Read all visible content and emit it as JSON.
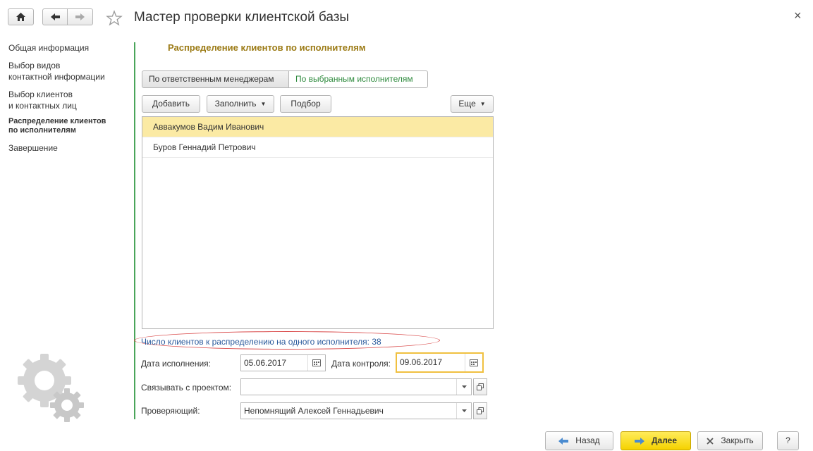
{
  "toolbar": {
    "title": "Мастер проверки клиентской базы",
    "close_glyph": "×"
  },
  "nav": {
    "items": [
      {
        "label": "Общая информация"
      },
      {
        "label": "Выбор видов\nконтактной информации"
      },
      {
        "label": "Выбор клиентов\nи контактных лиц"
      },
      {
        "label": "Распределение клиентов\nпо исполнителям",
        "active": true
      },
      {
        "label": "Завершение"
      }
    ]
  },
  "main": {
    "section_title": "Распределение клиентов по исполнителям",
    "segments": [
      "По ответственным менеджерам",
      "По выбранным исполнителям"
    ],
    "buttons": {
      "add": "Добавить",
      "fill": "Заполнить",
      "pick": "Подбор",
      "more": "Еще"
    },
    "list": {
      "rows": [
        "Аввакумов Вадим Иванович",
        "Буров Геннадий Петрович"
      ],
      "selected_index": 0
    },
    "info_text": "Число клиентов к распределению на одного исполнителя: 38",
    "fields": {
      "exec_date_label": "Дата исполнения:",
      "exec_date_value": "05.06.2017",
      "control_date_label": "Дата контроля:",
      "control_date_value": "09.06.2017",
      "project_label": "Связывать с проектом:",
      "project_value": "",
      "reviewer_label": "Проверяющий:",
      "reviewer_value": "Непомнящий Алексей Геннадьевич"
    }
  },
  "footer": {
    "back": "Назад",
    "next": "Далее",
    "close": "Закрыть",
    "help": "?"
  },
  "colors": {
    "accent_green": "#4aa55a",
    "section_title": "#9b7a14",
    "selected_row": "#fbeaa4",
    "highlight_ellipse": "#d94848",
    "primary_button": "#f5d200"
  }
}
